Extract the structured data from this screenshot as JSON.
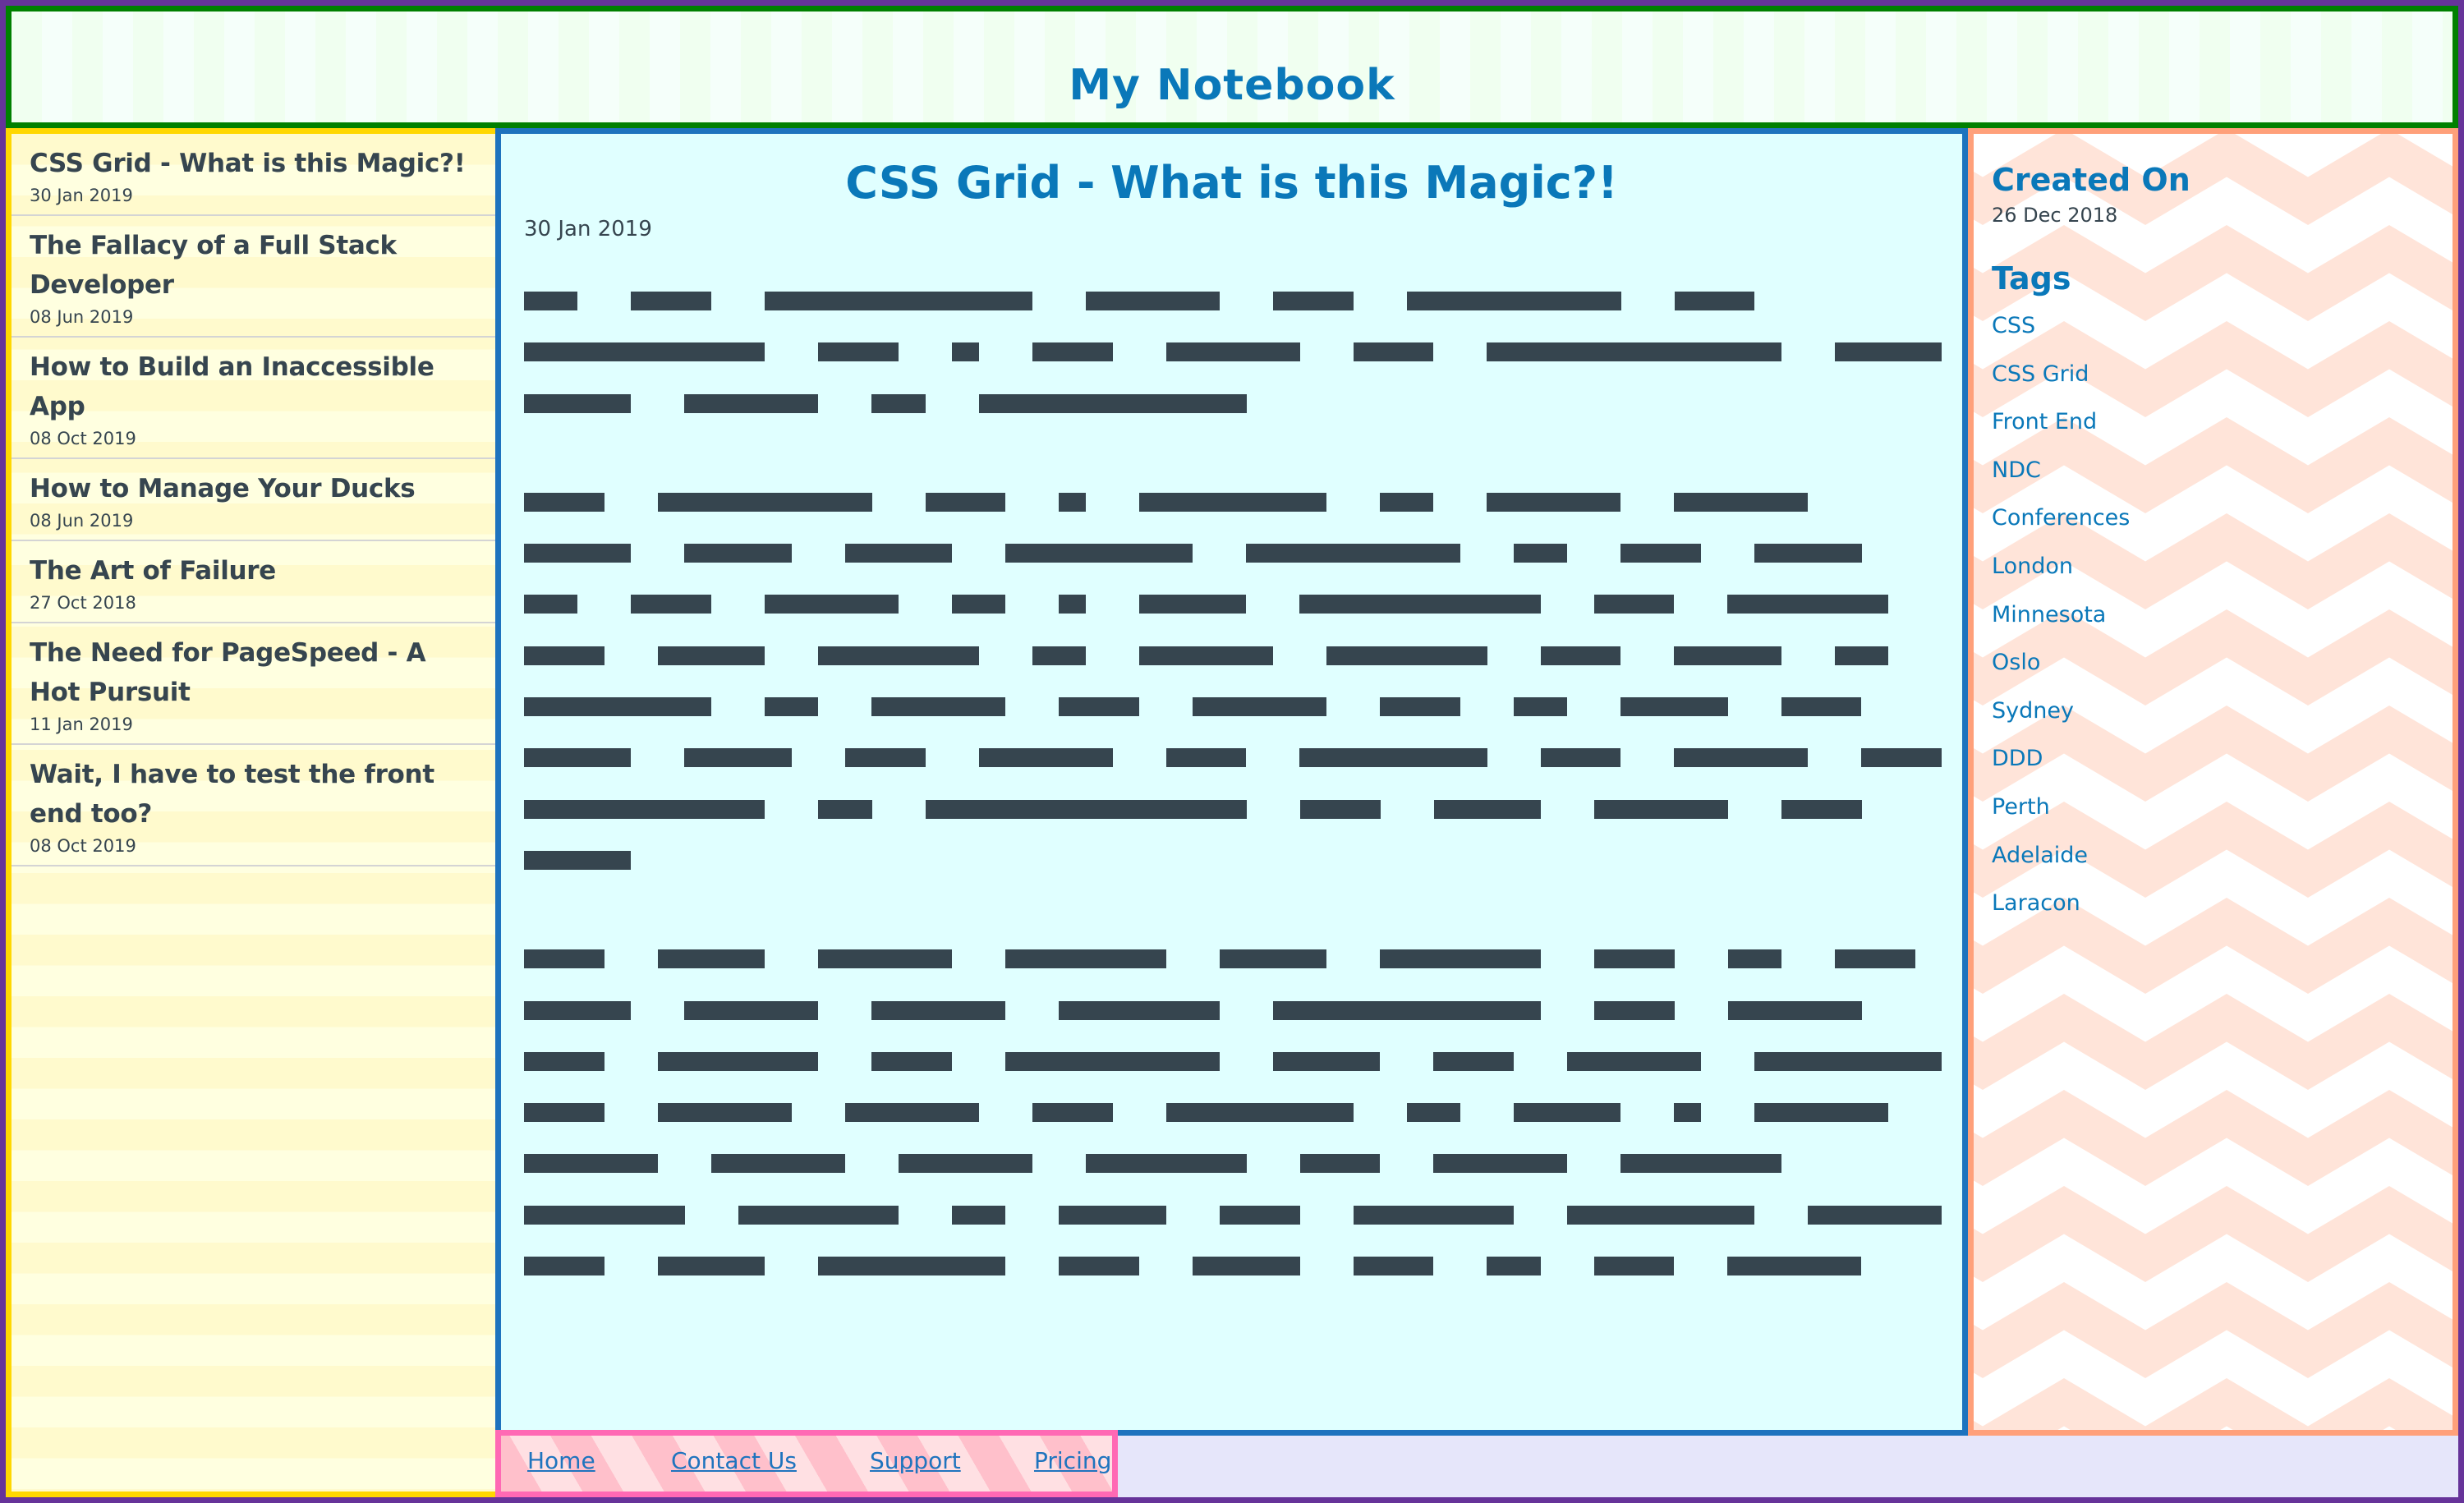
{
  "header": {
    "title": "My Notebook"
  },
  "sidebar": {
    "posts": [
      {
        "title": "CSS Grid - What is this Magic?!",
        "date": "30 Jan 2019"
      },
      {
        "title": "The Fallacy of a Full Stack Developer",
        "date": "08 Jun 2019"
      },
      {
        "title": "How to Build an Inaccessible App",
        "date": "08 Oct 2019"
      },
      {
        "title": "How to Manage Your Ducks",
        "date": "08 Jun 2019"
      },
      {
        "title": "The Art of Failure",
        "date": "27 Oct 2018"
      },
      {
        "title": "The Need for PageSpeed - A Hot Pursuit",
        "date": "11 Jan 2019"
      },
      {
        "title": "Wait, I have to test the front end too?",
        "date": "08 Oct 2019"
      }
    ]
  },
  "main": {
    "title": "CSS Grid - What is this Magic?!",
    "date": "30 Jan 2019",
    "redacted_paragraphs_word_lengths": [
      [
        [
          2,
          3,
          10,
          5,
          3,
          8,
          3
        ],
        [
          9,
          3,
          1,
          3,
          5,
          3,
          11,
          4
        ],
        [
          4,
          5,
          2,
          10
        ]
      ],
      [
        [
          3,
          8,
          3,
          1,
          7,
          2,
          5,
          5
        ],
        [
          4,
          4,
          4,
          7,
          8,
          2,
          3,
          4
        ],
        [
          2,
          3,
          5,
          2,
          1,
          4,
          9,
          3,
          6
        ],
        [
          3,
          4,
          6,
          2,
          5,
          6,
          3,
          4,
          2
        ],
        [
          7,
          2,
          5,
          3,
          5,
          3,
          2,
          4,
          3
        ],
        [
          4,
          4,
          3,
          5,
          3,
          7,
          3,
          5,
          3
        ],
        [
          9,
          2,
          12,
          3,
          4,
          5,
          3
        ],
        [
          4
        ]
      ],
      [
        [
          3,
          4,
          5,
          6,
          4,
          6,
          3,
          2,
          3
        ],
        [
          4,
          5,
          5,
          6,
          10,
          3,
          5
        ],
        [
          3,
          6,
          3,
          8,
          4,
          3,
          5,
          7
        ],
        [
          3,
          5,
          5,
          3,
          7,
          2,
          4,
          1,
          5
        ],
        [
          5,
          5,
          5,
          6,
          3,
          5,
          6
        ],
        [
          6,
          6,
          2,
          4,
          3,
          6,
          7,
          5
        ],
        [
          3,
          4,
          7,
          3,
          4,
          3,
          2,
          3,
          5
        ]
      ]
    ]
  },
  "aside": {
    "created_heading": "Created On",
    "created_date": "26 Dec 2018",
    "tags_heading": "Tags",
    "tags": [
      "CSS",
      "CSS Grid",
      "Front End",
      "NDC",
      "Conferences",
      "London",
      "Minnesota",
      "Oslo",
      "Sydney",
      "DDD",
      "Perth",
      "Adelaide",
      "Laracon"
    ]
  },
  "footer": {
    "links": [
      "Home",
      "Contact Us",
      "Support",
      "Pricing"
    ]
  },
  "colors": {
    "page_border": "#663399",
    "header_border": "#008000",
    "sidebar_border": "#ffd700",
    "main_border": "#1e73be",
    "aside_border": "#ffa07a",
    "footer_border": "#ff69b4",
    "accent_text": "#0a78b9",
    "body_text": "#36454f"
  }
}
